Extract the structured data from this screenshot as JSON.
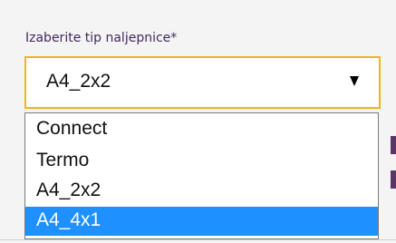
{
  "field": {
    "label": "Izaberite tip naljepnice",
    "required_marker": "*"
  },
  "select": {
    "value": "A4_2x2",
    "arrow_icon": "triangle-down-icon",
    "focus_border_color": "#f0b321"
  },
  "dropdown": {
    "options": [
      {
        "label": "Connect",
        "selected": false
      },
      {
        "label": "Termo",
        "selected": false
      },
      {
        "label": "A4_2x2",
        "selected": false
      },
      {
        "label": "A4_4x1",
        "selected": true
      }
    ],
    "highlight_color": "#1e90ff"
  }
}
